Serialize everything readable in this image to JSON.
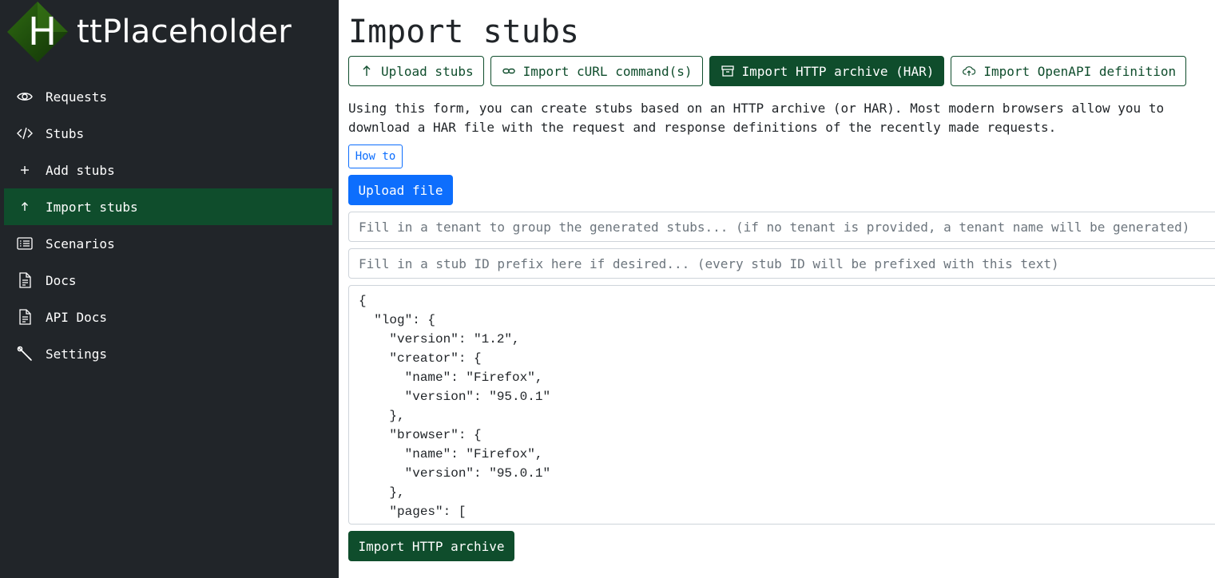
{
  "app": {
    "logo_letter": "H",
    "logo_text": "ttPlaceholder",
    "colors": {
      "sidebar_bg": "#212529",
      "accent_green": "#0f4d2c",
      "primary_blue": "#0d6efd"
    }
  },
  "sidebar": {
    "items": [
      {
        "label": "Requests",
        "icon": "eye-icon",
        "active": false
      },
      {
        "label": "Stubs",
        "icon": "code-icon",
        "active": false
      },
      {
        "label": "Add stubs",
        "icon": "plus-icon",
        "active": false
      },
      {
        "label": "Import stubs",
        "icon": "arrow-up-icon",
        "active": true
      },
      {
        "label": "Scenarios",
        "icon": "list-icon",
        "active": false
      },
      {
        "label": "Docs",
        "icon": "document-icon",
        "active": false
      },
      {
        "label": "API Docs",
        "icon": "document-icon",
        "active": false
      },
      {
        "label": "Settings",
        "icon": "wrench-icon",
        "active": false
      }
    ]
  },
  "main": {
    "title": "Import stubs",
    "tabs": [
      {
        "label": "Upload stubs",
        "icon": "arrow-up-icon",
        "active": false
      },
      {
        "label": "Import cURL command(s)",
        "icon": "link-icon",
        "active": false
      },
      {
        "label": "Import HTTP archive (HAR)",
        "icon": "archive-icon",
        "active": true
      },
      {
        "label": "Import OpenAPI definition",
        "icon": "cloud-upload-icon",
        "active": false
      }
    ],
    "description": "Using this form, you can create stubs based on an HTTP archive (or HAR). Most modern browsers allow you to download a HAR file with the request and response definitions of the recently made requests.",
    "how_to_label": "How to",
    "upload_file_label": "Upload file",
    "tenant_placeholder": "Fill in a tenant to group the generated stubs... (if no tenant is provided, a tenant name will be generated)",
    "prefix_placeholder": "Fill in a stub ID prefix here if desired... (every stub ID will be prefixed with this text)",
    "har_content": "{\n  \"log\": {\n    \"version\": \"1.2\",\n    \"creator\": {\n      \"name\": \"Firefox\",\n      \"version\": \"95.0.1\"\n    },\n    \"browser\": {\n      \"name\": \"Firefox\",\n      \"version\": \"95.0.1\"\n    },\n    \"pages\": [",
    "import_button_label": "Import HTTP archive"
  }
}
